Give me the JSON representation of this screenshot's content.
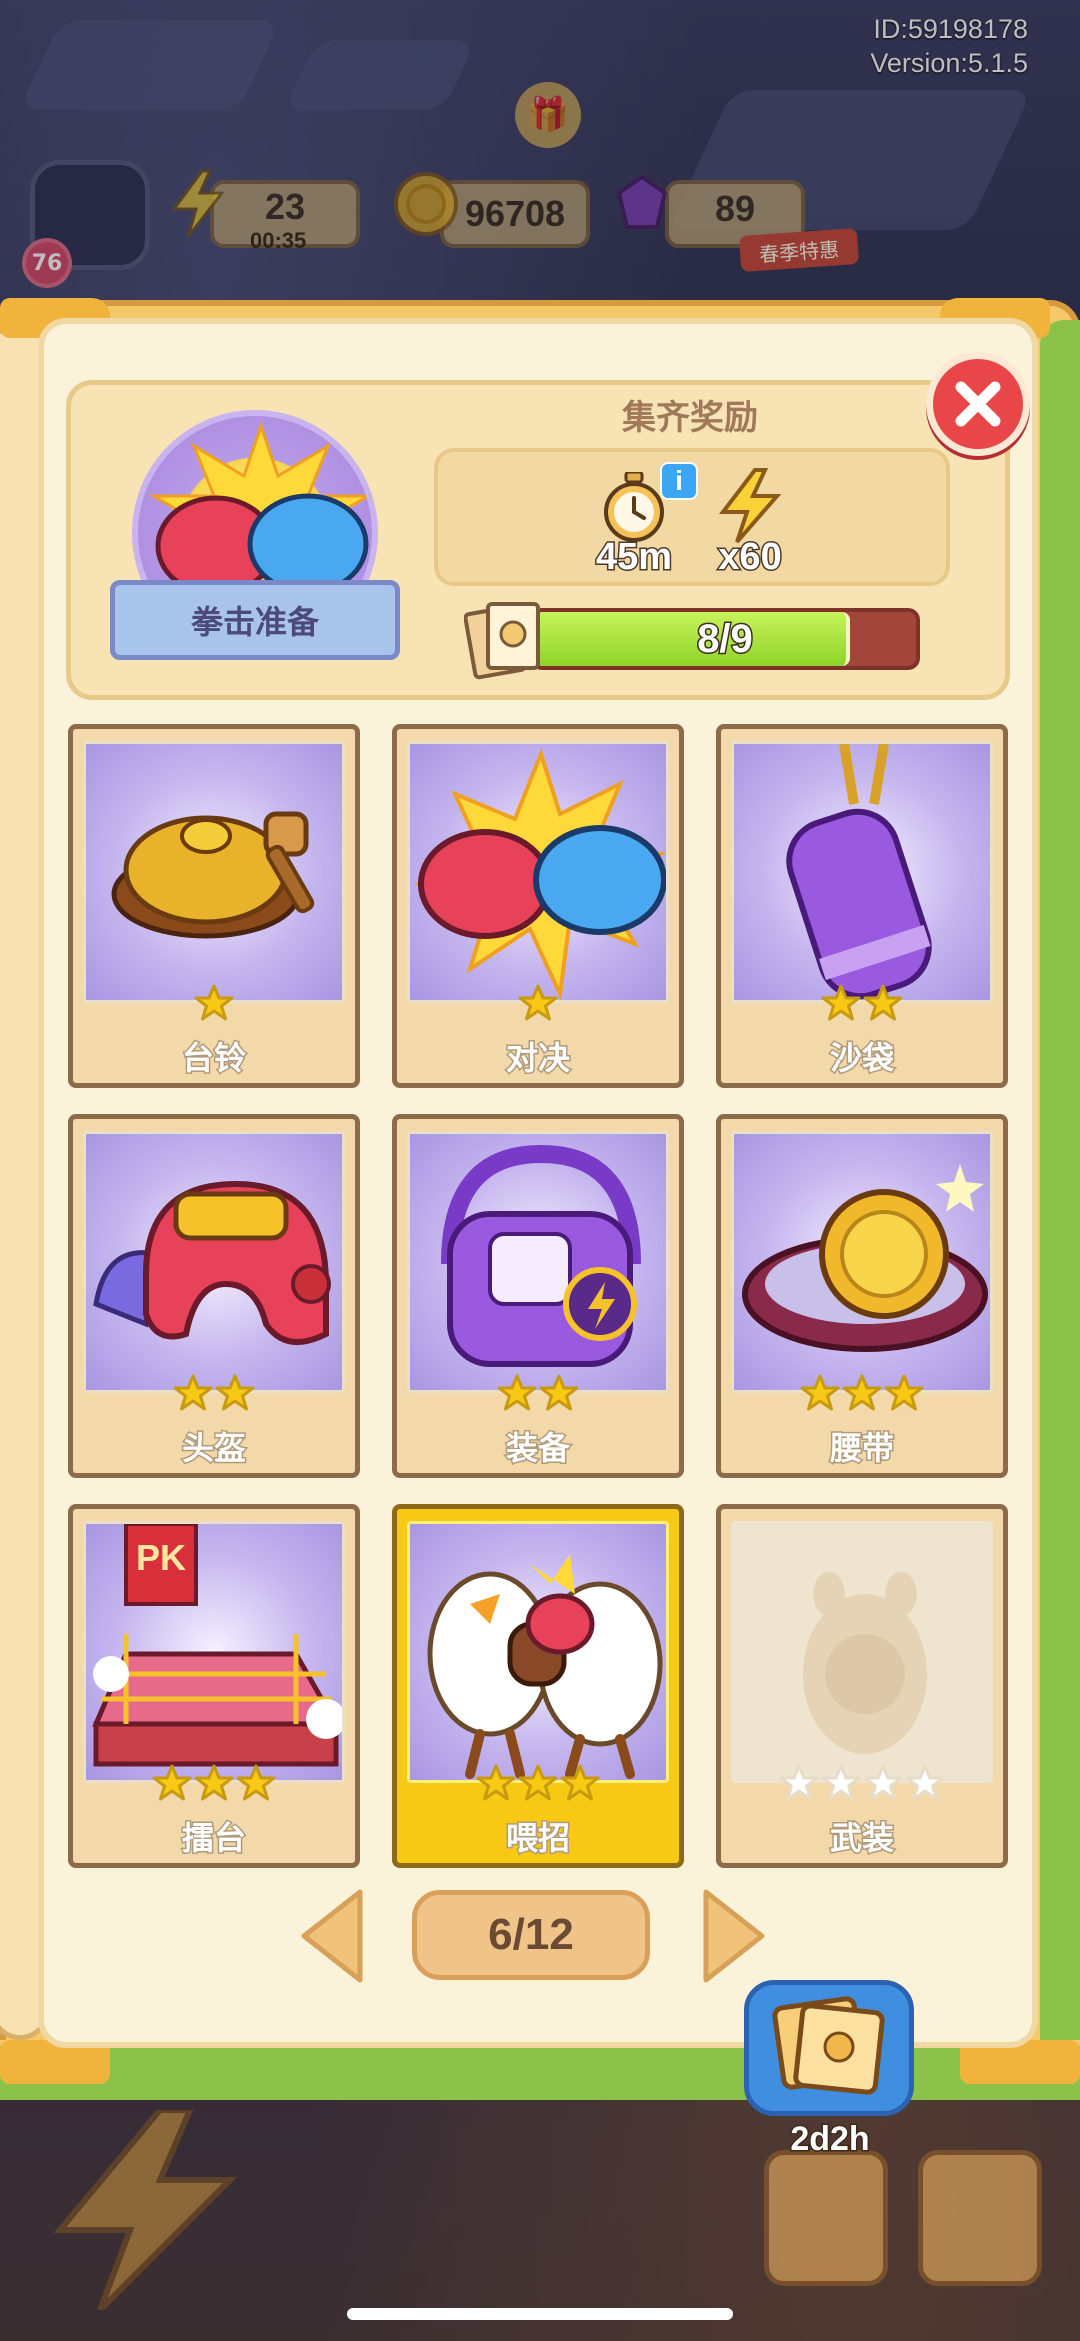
{
  "status": {
    "id_text": "ID:59198178",
    "version_text": "Version:5.1.5"
  },
  "player": {
    "level": "76"
  },
  "resources": {
    "energy": {
      "value": "23",
      "timer": "00:35"
    },
    "coins": {
      "value": "96708"
    },
    "gems": {
      "value": "89"
    }
  },
  "promo": {
    "label": "春季特惠"
  },
  "reward": {
    "title": "集齐奖励",
    "set_name": "拳击准备",
    "items": [
      {
        "icon": "stopwatch-icon",
        "label": "45m"
      },
      {
        "icon": "lightning-icon",
        "label": "x60"
      }
    ],
    "progress": {
      "text": "8/9",
      "collected": 8,
      "total": 9
    }
  },
  "cards": [
    {
      "name": "台铃",
      "stars": 1,
      "max_stars": 1,
      "art": "bell",
      "state": "collected"
    },
    {
      "name": "对决",
      "stars": 1,
      "max_stars": 1,
      "art": "gloves",
      "state": "collected"
    },
    {
      "name": "沙袋",
      "stars": 2,
      "max_stars": 2,
      "art": "punching-bag",
      "state": "collected"
    },
    {
      "name": "头盔",
      "stars": 2,
      "max_stars": 2,
      "art": "helmet",
      "state": "collected"
    },
    {
      "name": "装备",
      "stars": 2,
      "max_stars": 2,
      "art": "gear-bag",
      "state": "collected"
    },
    {
      "name": "腰带",
      "stars": 3,
      "max_stars": 3,
      "art": "belt",
      "state": "collected"
    },
    {
      "name": "擂台",
      "stars": 3,
      "max_stars": 3,
      "art": "ring",
      "state": "collected"
    },
    {
      "name": "喂招",
      "stars": 3,
      "max_stars": 3,
      "art": "sparring",
      "state": "highlighted"
    },
    {
      "name": "武装",
      "stars": 0,
      "max_stars": 4,
      "art": "silhouette",
      "state": "locked"
    }
  ],
  "pager": {
    "text": "6/12"
  },
  "album": {
    "timer": "2d2h"
  },
  "colors": {
    "star": "#f7c814",
    "progress_fill": "#9ad934",
    "close": "#e9464a",
    "gold_card": "#f7c914"
  }
}
